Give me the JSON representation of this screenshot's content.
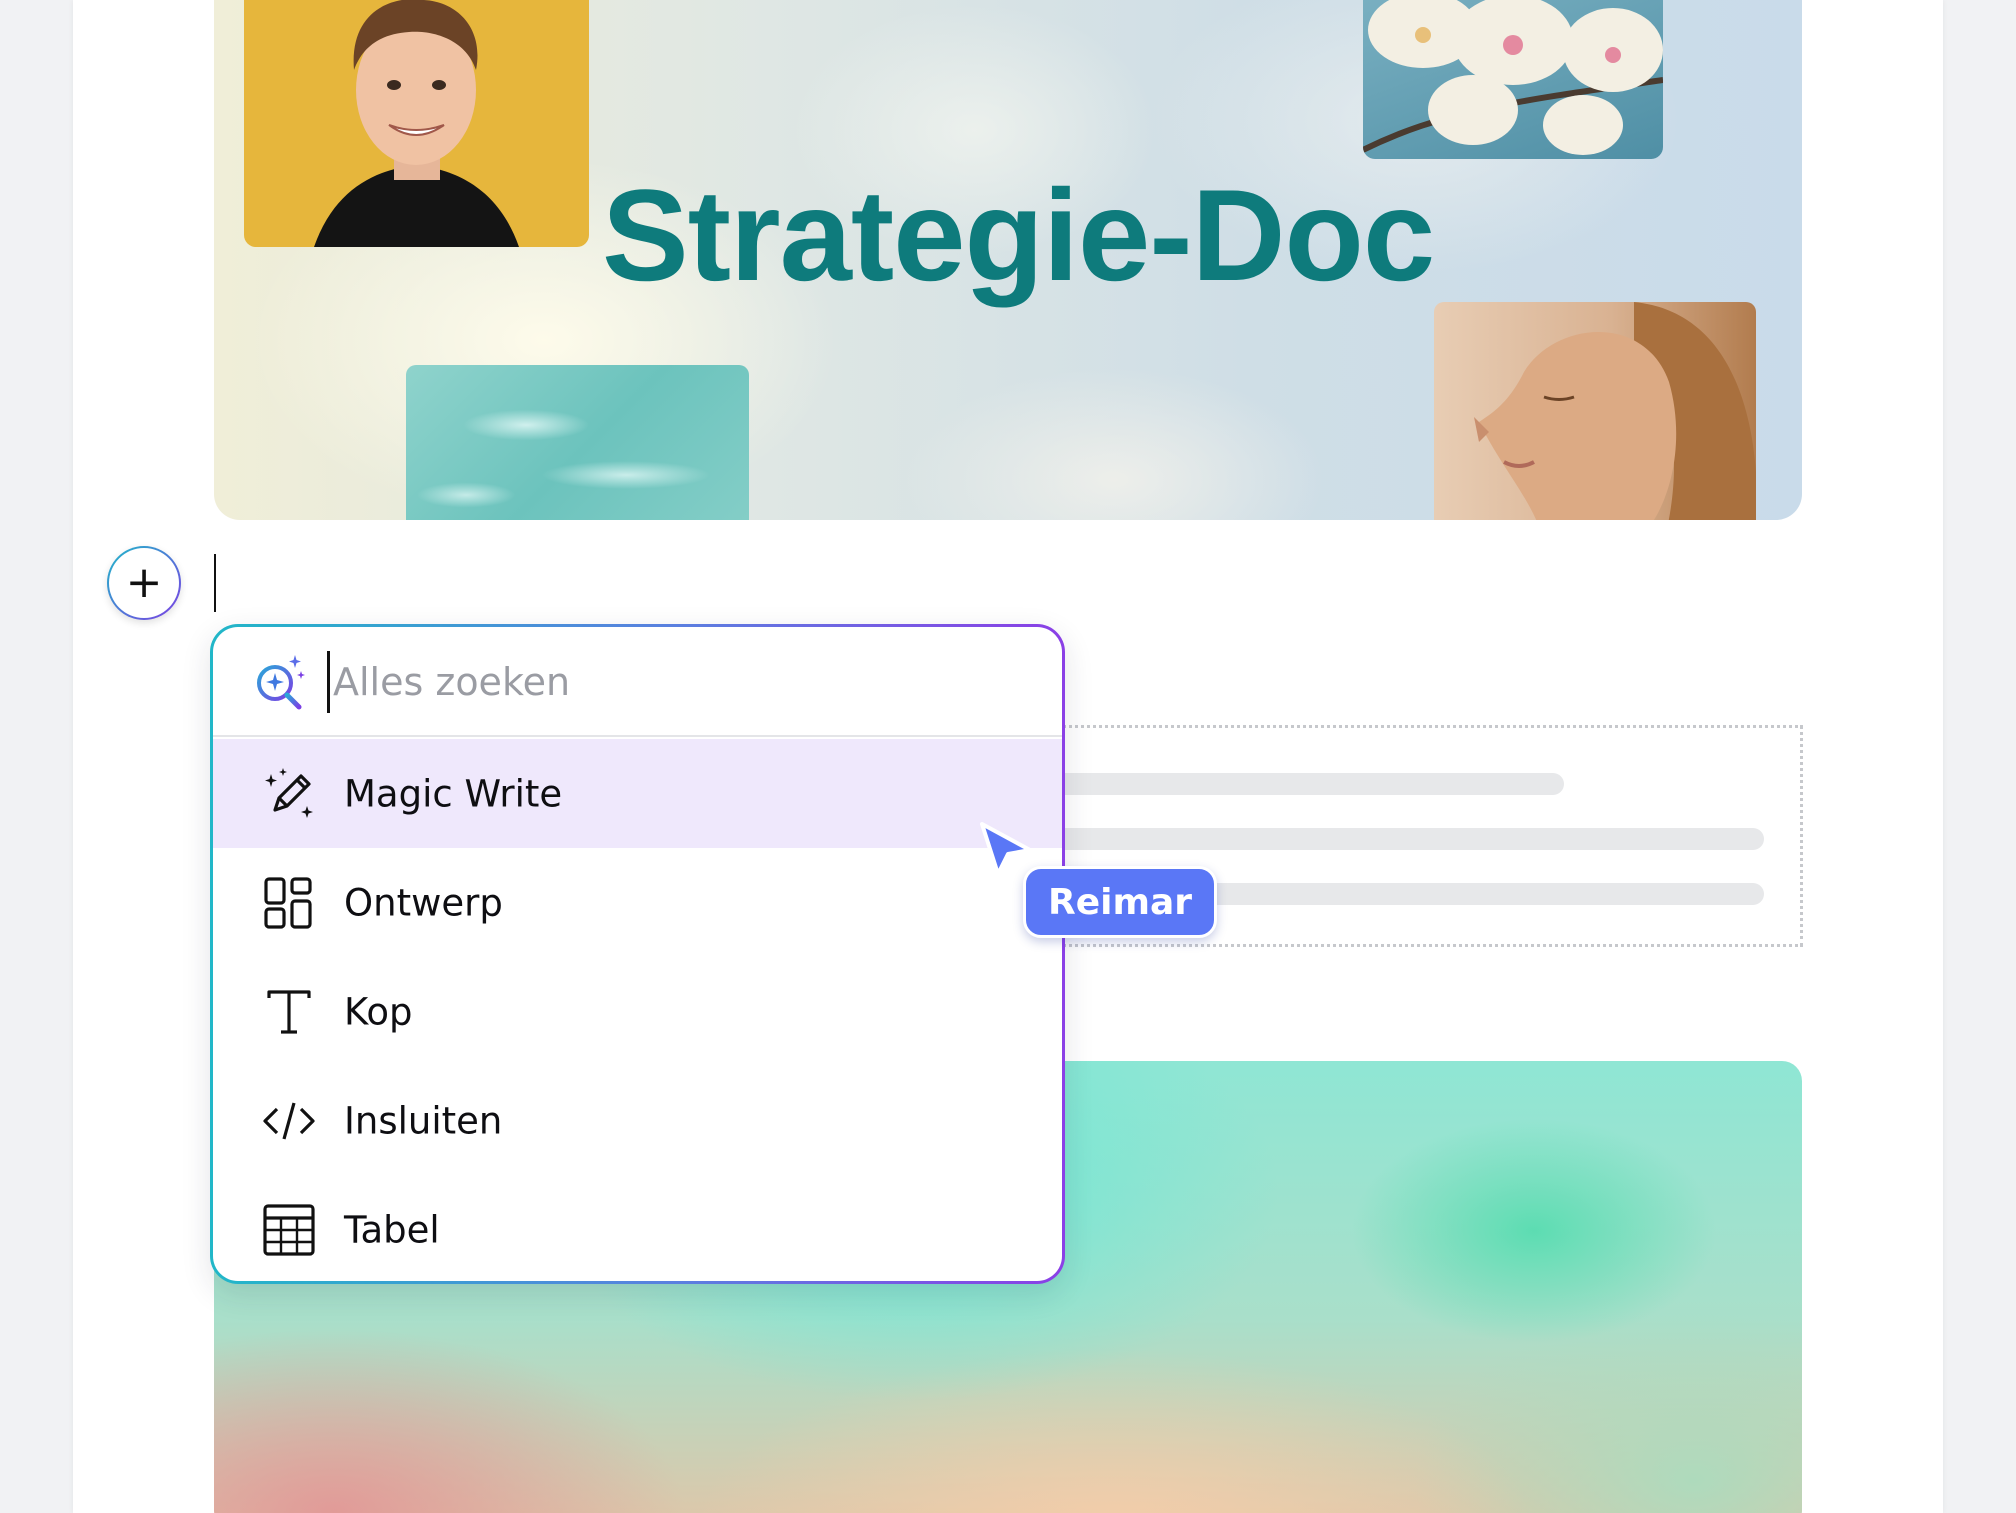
{
  "document": {
    "title": "Strategie-Doc"
  },
  "insert_menu": {
    "search_placeholder": "Alles zoeken",
    "items": [
      {
        "label": "Magic Write",
        "icon": "magic-pencil-icon",
        "highlighted": true
      },
      {
        "label": "Ontwerp",
        "icon": "design-grid-icon",
        "highlighted": false
      },
      {
        "label": "Kop",
        "icon": "heading-t-icon",
        "highlighted": false
      },
      {
        "label": "Insluiten",
        "icon": "embed-code-icon",
        "highlighted": false
      },
      {
        "label": "Tabel",
        "icon": "table-icon",
        "highlighted": false
      }
    ]
  },
  "collaborator": {
    "name": "Reimar",
    "color": "#5a77f6"
  },
  "colors": {
    "title": "#0e7b7c",
    "menu_highlight": "#efe8fc",
    "menu_border_start": "#21b7c8",
    "menu_border_end": "#8b3fe6"
  }
}
